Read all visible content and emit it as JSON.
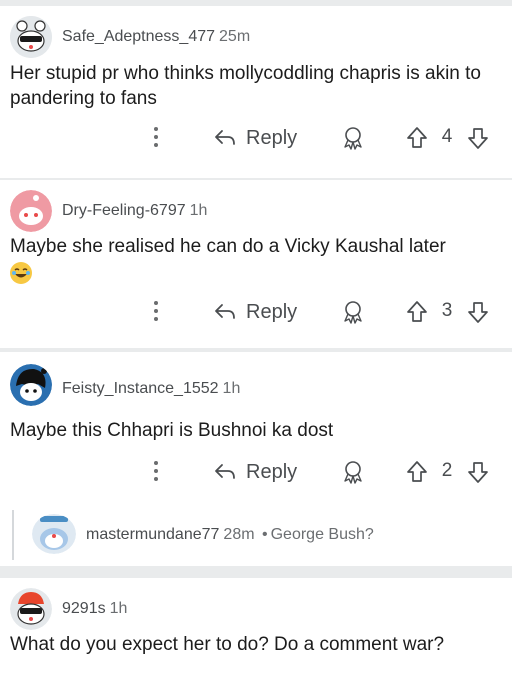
{
  "comments": [
    {
      "username": "Safe_Adeptness_477",
      "time": "25m",
      "text": "Her stupid pr who thinks mollycoddling chapris is akin to pandering to fans",
      "reply_label": "Reply",
      "score": "4"
    },
    {
      "username": "Dry-Feeling-6797",
      "time": "1h",
      "text": "Maybe she realised he can do a Vicky Kaushal later",
      "reply_label": "Reply",
      "score": "3"
    },
    {
      "username": "Feisty_Instance_1552",
      "time": "1h",
      "text": "Maybe this Chhapri is Bushnoi ka dost",
      "reply_label": "Reply",
      "score": "2"
    },
    {
      "username": "9291s",
      "time": "1h",
      "text": "What do you expect her to do? Do a comment war?"
    }
  ],
  "collapsed_reply": {
    "username": "mastermundane77",
    "time": "28m",
    "separator": "•",
    "snippet": "George Bush?"
  },
  "emoji": "laughing-tears-emoji",
  "colors": {
    "background": "#e9ebec",
    "card": "#ffffff",
    "text": "#1c1c1c",
    "meta": "#4a4d50"
  }
}
